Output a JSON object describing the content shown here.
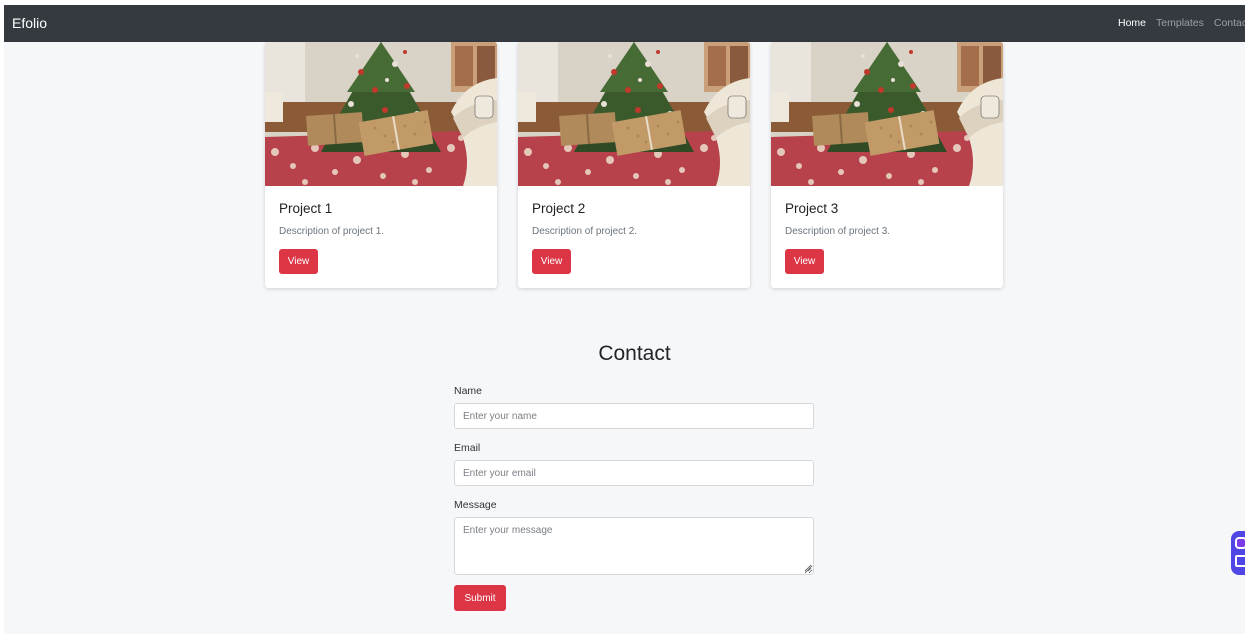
{
  "navbar": {
    "brand": "Efolio",
    "links": [
      {
        "label": "Home",
        "active": true
      },
      {
        "label": "Templates",
        "active": false
      },
      {
        "label": "Contact",
        "active": false
      }
    ]
  },
  "projects": [
    {
      "title": "Project 1",
      "description": "Description of project 1.",
      "button": "View",
      "image": "christmas-tree-living-room"
    },
    {
      "title": "Project 2",
      "description": "Description of project 2.",
      "button": "View",
      "image": "christmas-tree-living-room"
    },
    {
      "title": "Project 3",
      "description": "Description of project 3.",
      "button": "View",
      "image": "christmas-tree-living-room"
    }
  ],
  "contact": {
    "title": "Contact",
    "name_label": "Name",
    "name_placeholder": "Enter your name",
    "email_label": "Email",
    "email_placeholder": "Enter your email",
    "message_label": "Message",
    "message_placeholder": "Enter your message",
    "submit": "Submit"
  },
  "colors": {
    "navbar": "#343a40",
    "accent": "#dc3545",
    "page_bg": "#f6f7f9",
    "widget": "#4f46e5"
  },
  "icons": {
    "floating_widget": "chat-widget-icon",
    "resize_grip": "resize-grip-icon"
  }
}
